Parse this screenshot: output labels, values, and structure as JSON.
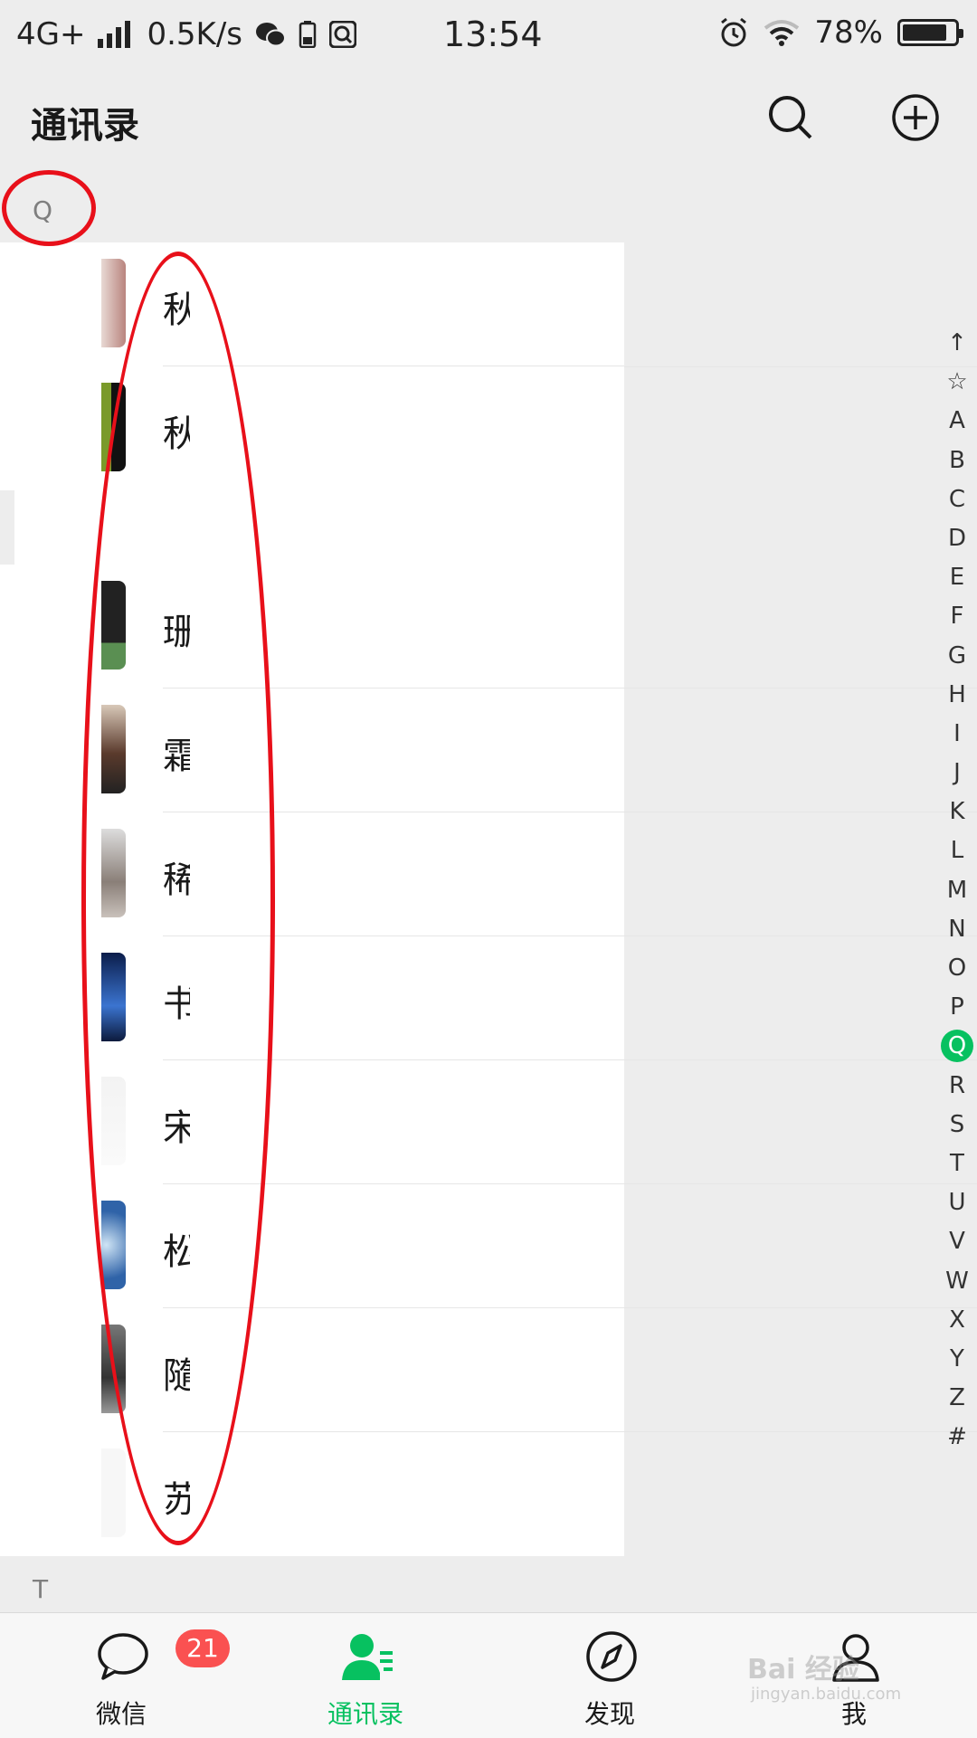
{
  "status_bar": {
    "network": "4G+",
    "speed": "0.5K/s",
    "time": "13:54",
    "battery_percent": "78%",
    "battery_level": 0.78
  },
  "header": {
    "title": "通讯录",
    "search_icon": "search-icon",
    "add_icon": "plus-circle-icon"
  },
  "sections": {
    "q": "Q",
    "t": "T"
  },
  "contacts_q_first": [
    {
      "name": "秋",
      "avatar_color": "#c9a5a0"
    },
    {
      "name": "秋",
      "avatar_color": "#1a1a1a"
    }
  ],
  "contacts_q_second": [
    {
      "name": "珊",
      "avatar_color": "#2b2b2b"
    },
    {
      "name": "霜",
      "avatar_color": "#6b4a3a"
    },
    {
      "name": "稀",
      "avatar_color": "#b0a9a4"
    },
    {
      "name": "书",
      "avatar_color": "#1c3d80"
    },
    {
      "name": "宋",
      "avatar_color": "#eeeeee"
    },
    {
      "name": "松",
      "avatar_color": "#3e6fa8"
    },
    {
      "name": "隨",
      "avatar_color": "#555555"
    },
    {
      "name": "苏",
      "avatar_color": "#f4f4f4"
    }
  ],
  "index_bar": [
    "↑",
    "☆",
    "A",
    "B",
    "C",
    "D",
    "E",
    "F",
    "G",
    "H",
    "I",
    "J",
    "K",
    "L",
    "M",
    "N",
    "O",
    "P",
    "Q",
    "R",
    "S",
    "T",
    "U",
    "V",
    "W",
    "X",
    "Y",
    "Z",
    "#"
  ],
  "index_active": "Q",
  "tab_bar": {
    "tabs": [
      {
        "label": "微信",
        "icon": "chat-bubble-icon",
        "badge": "21"
      },
      {
        "label": "通讯录",
        "icon": "contacts-icon"
      },
      {
        "label": "发现",
        "icon": "compass-icon"
      },
      {
        "label": "我",
        "icon": "person-icon"
      }
    ]
  },
  "watermark": {
    "line1": "Bai  经验",
    "line2": "jingyan.baidu.com"
  },
  "colors": {
    "accent": "#07c160",
    "badge": "#fa5151",
    "annotation": "#e8101a"
  }
}
